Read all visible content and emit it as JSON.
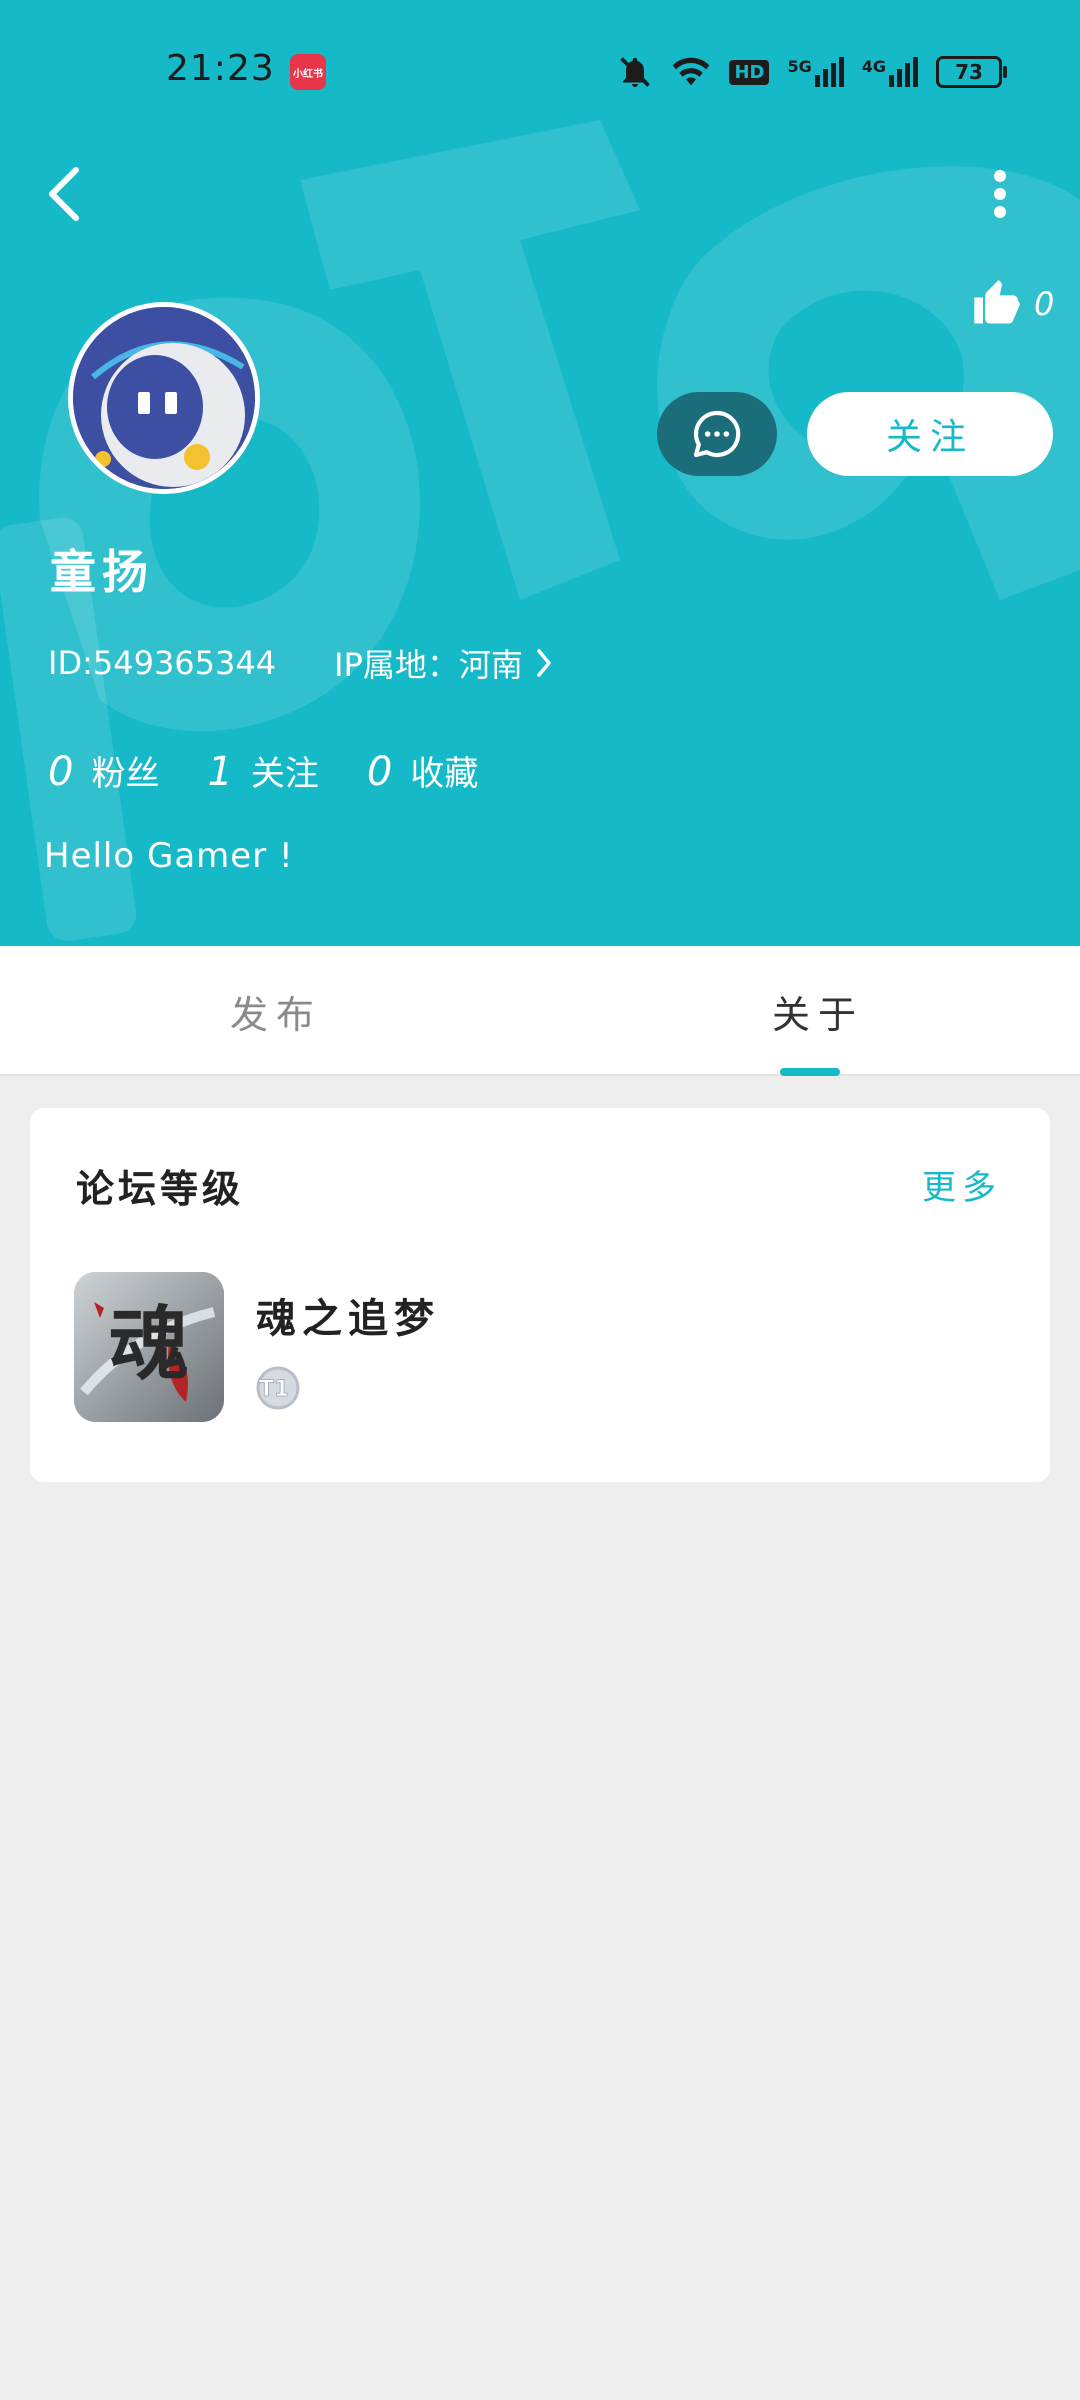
{
  "status_bar": {
    "time": "21:23",
    "app_badge": "小红书",
    "hd_label": "HD",
    "signal_1": "5G",
    "signal_2": "4G",
    "battery": "73"
  },
  "header": {
    "like_count": "0",
    "follow_label": "关注",
    "username": "童扬",
    "id_text": "ID:549365344",
    "ip_text": "IP属地：河南",
    "stats": [
      {
        "num": "0",
        "label": "粉丝"
      },
      {
        "num": "1",
        "label": "关注"
      },
      {
        "num": "0",
        "label": "收藏"
      }
    ],
    "bio": "Hello Gamer !"
  },
  "tabs": [
    {
      "label": "发布"
    },
    {
      "label": "关于"
    }
  ],
  "active_tab": "关于",
  "forum_card": {
    "title": "论坛等级",
    "more": "更多",
    "game_name": "魂之追梦",
    "game_icon_text": "魂",
    "level_badge": "T1"
  },
  "colors": {
    "accent": "#15b9c8",
    "message_button": "#1a6d79",
    "background": "#eeeeee"
  },
  "icons": {
    "back": "back-chevron-icon",
    "more": "more-vertical-icon",
    "like": "thumbs-up-icon",
    "message": "chat-bubble-icon",
    "ip_chevron": "chevron-right-icon",
    "mute": "bell-off-icon",
    "wifi": "wifi-icon"
  }
}
